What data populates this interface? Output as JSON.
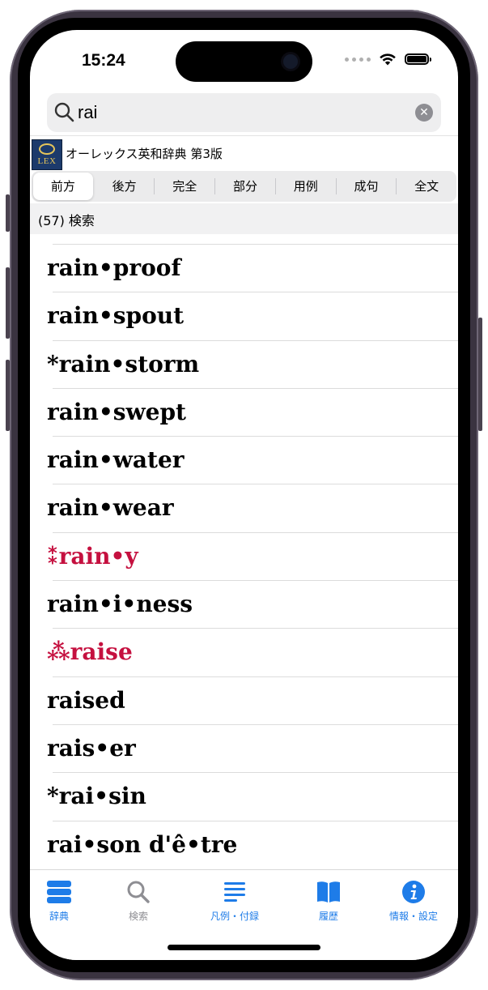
{
  "status": {
    "time": "15:24"
  },
  "search": {
    "query": "rai"
  },
  "dictionary": {
    "name": "オーレックス英和辞典 第3版",
    "logo_text": "LEX"
  },
  "segments": [
    {
      "label": "前方",
      "active": true
    },
    {
      "label": "後方"
    },
    {
      "label": "完全"
    },
    {
      "label": "部分"
    },
    {
      "label": "用例"
    },
    {
      "label": "成句"
    },
    {
      "label": "全文"
    }
  ],
  "result_count": "(57) 検索",
  "entries": [
    {
      "word": "rain•proof"
    },
    {
      "word": "rain•spout"
    },
    {
      "word": "*rain•storm"
    },
    {
      "word": "rain•swept"
    },
    {
      "word": "rain•water"
    },
    {
      "word": "rain•wear"
    },
    {
      "word": "⁑rain•y",
      "color": "#c5103f"
    },
    {
      "word": "rain•i•ness"
    },
    {
      "word": "⁂raise",
      "color": "#c5103f"
    },
    {
      "word": "raised"
    },
    {
      "word": "rais•er"
    },
    {
      "word": "*rai•sin"
    },
    {
      "word": "rai•son d'ê•tre"
    }
  ],
  "tabbar": [
    {
      "label": "辞典",
      "icon": "stack-icon",
      "active": true
    },
    {
      "label": "検索",
      "icon": "search-icon",
      "active": false
    },
    {
      "label": "凡例・付録",
      "icon": "list-icon",
      "active": true
    },
    {
      "label": "履歴",
      "icon": "book-icon",
      "active": true
    },
    {
      "label": "情報・設定",
      "icon": "info-icon",
      "active": true
    }
  ],
  "colors": {
    "accent": "#1e7ce8",
    "highlight": "#c5103f"
  }
}
